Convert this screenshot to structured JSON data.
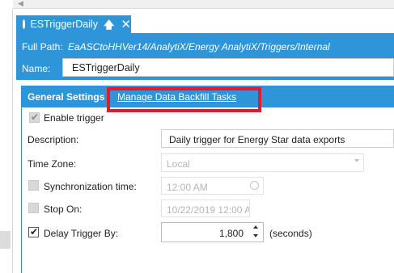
{
  "tab": {
    "title": "ESTriggerDaily",
    "icon": "clock-icon",
    "pin_icon": "pin-icon",
    "close_icon": "close-icon"
  },
  "header": {
    "full_path_label": "Full Path:",
    "full_path_value": "EaASCtoHHVer14/AnalytiX/Energy AnalytiX/Triggers/Internal",
    "name_label": "Name:",
    "name_value": "ESTriggerDaily"
  },
  "general_settings": {
    "title": "General Settings",
    "backfill_link": "Manage Data Backfill Tasks",
    "enable_trigger": {
      "label": "Enable trigger",
      "checked": true,
      "enabled": false
    },
    "description": {
      "label": "Description:",
      "value": "Daily trigger for Energy Star data exports"
    },
    "time_zone": {
      "label": "Time Zone:",
      "value": "Local",
      "enabled": false
    },
    "synchronization_time": {
      "label": "Synchronization time:",
      "checked": false,
      "value": "12:00 AM",
      "enabled": false
    },
    "stop_on": {
      "label": "Stop On:",
      "checked": false,
      "value": "10/22/2019 12:00 A",
      "enabled": false
    },
    "delay_trigger_by": {
      "label": "Delay Trigger By:",
      "checked": true,
      "value": "1,800",
      "unit": "(seconds)"
    }
  },
  "colors": {
    "accent": "#2d95d8",
    "highlight": "#e01b2a"
  }
}
